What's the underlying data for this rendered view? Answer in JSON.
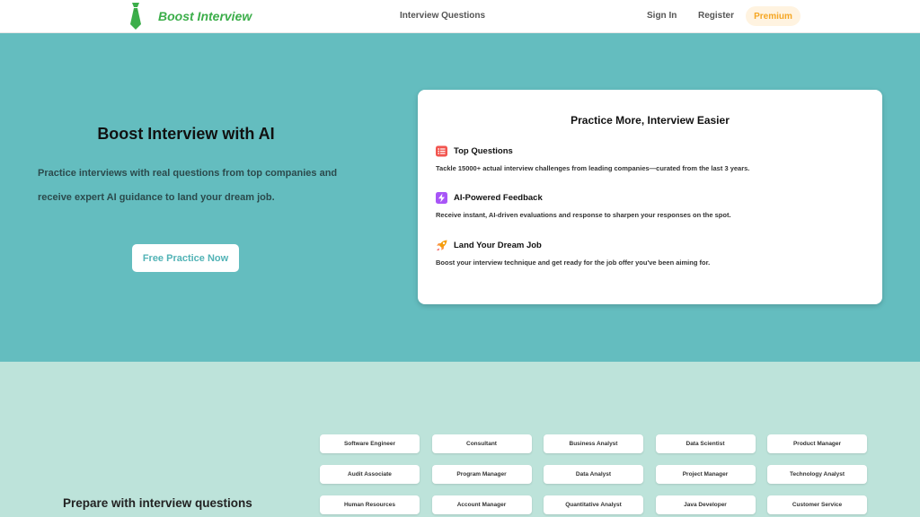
{
  "header": {
    "logo_text": "Boost Interview",
    "nav": {
      "interview_questions": "Interview Questions",
      "sign_in": "Sign In",
      "register": "Register",
      "premium": "Premium"
    }
  },
  "hero": {
    "title": "Boost Interview with AI",
    "description": "Practice interviews with real questions from top companies and receive expert AI guidance to land your dream job.",
    "cta": "Free Practice Now"
  },
  "card": {
    "title": "Practice More, Interview Easier",
    "features": [
      {
        "icon": "list-icon",
        "title": "Top Questions",
        "description": "Tackle 15000+ actual interview challenges from leading companies—curated from the last 3 years."
      },
      {
        "icon": "lightning-icon",
        "title": "AI-Powered Feedback",
        "description": "Receive instant, AI-driven evaluations and response to sharpen your responses on the spot."
      },
      {
        "icon": "rocket-icon",
        "title": "Land Your Dream Job",
        "description": "Boost your interview technique and get ready for the job offer you've been aiming for."
      }
    ]
  },
  "prepare": {
    "title": "Prepare with interview questions",
    "roles": [
      "Software Engineer",
      "Consultant",
      "Business Analyst",
      "Data Scientist",
      "Product Manager",
      "Audit Associate",
      "Program Manager",
      "Data Analyst",
      "Project Manager",
      "Technology Analyst",
      "Human Resources",
      "Account Manager",
      "Quantitative Analyst",
      "Java Developer",
      "Customer Service"
    ]
  },
  "colors": {
    "brand_green": "#3cae4a",
    "hero_bg": "#64bdbf",
    "lower_bg": "#bde3da",
    "premium_text": "#f5a623",
    "premium_bg": "#fff3e0"
  }
}
